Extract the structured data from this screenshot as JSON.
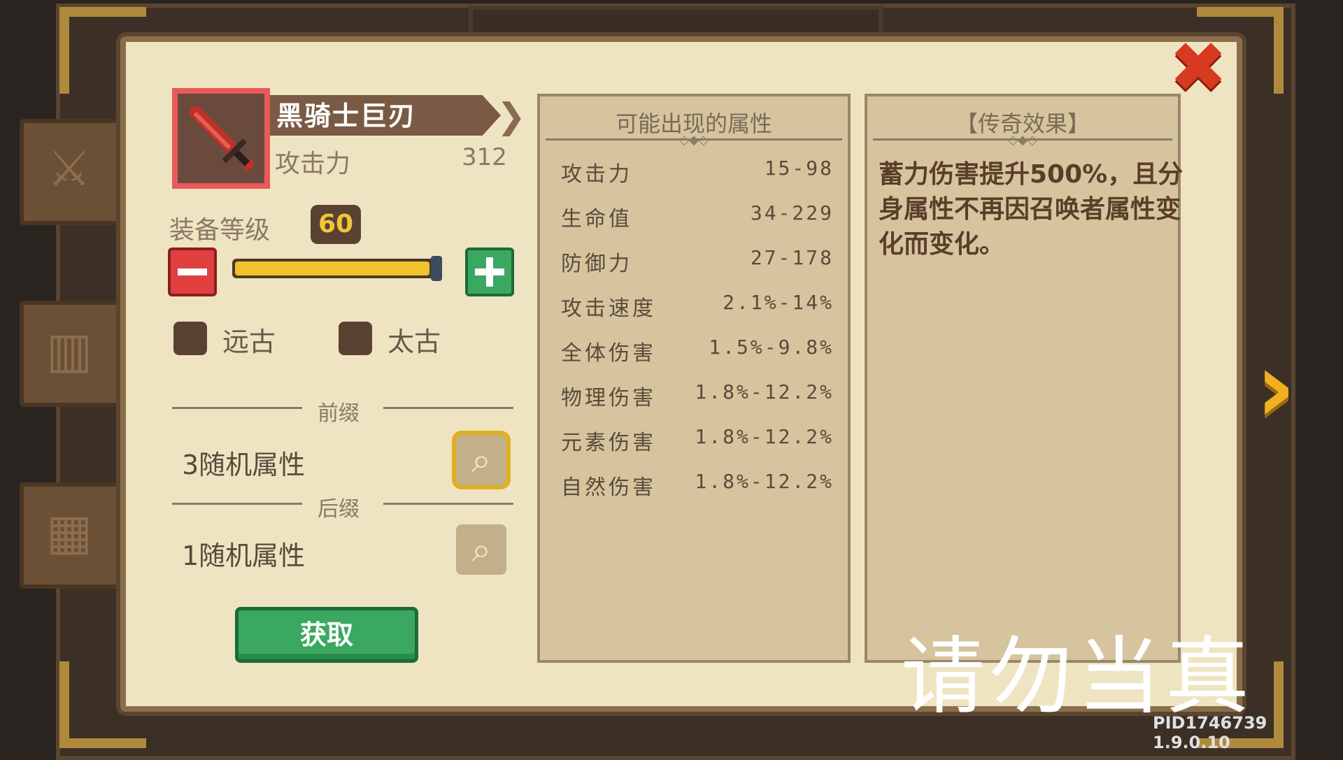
{
  "item": {
    "name": "黑骑士巨刃",
    "stat_label": "攻击力",
    "stat_value": "312"
  },
  "level": {
    "label": "装备等级",
    "value": "60",
    "slider_fraction": 1.0
  },
  "options": [
    {
      "label": "远古",
      "checked": false
    },
    {
      "label": "太古",
      "checked": false
    }
  ],
  "prefix": {
    "label": "前缀",
    "text": "3随机属性"
  },
  "suffix": {
    "label": "后缀",
    "text": "1随机属性"
  },
  "get_button": "获取",
  "possible_attrs": {
    "title": "可能出现的属性",
    "rows": [
      {
        "name": "攻击力",
        "range": "15-98"
      },
      {
        "name": "生命值",
        "range": "34-229"
      },
      {
        "name": "防御力",
        "range": "27-178"
      },
      {
        "name": "攻击速度",
        "range": "2.1%-14%"
      },
      {
        "name": "全体伤害",
        "range": "1.5%-9.8%"
      },
      {
        "name": "物理伤害",
        "range": "1.8%-12.2%"
      },
      {
        "name": "元素伤害",
        "range": "1.8%-12.2%"
      },
      {
        "name": "自然伤害",
        "range": "1.8%-12.2%"
      }
    ]
  },
  "legend": {
    "title": "【传奇效果】",
    "text": "蓄力伤害提升500%，且分身属性不再因召唤者属性变化而变化。"
  },
  "watermark": "请勿当真",
  "pid": "PID1746739 1.9.0.10",
  "icons": {
    "close": "close-icon",
    "next": "chevron-right-icon",
    "zoom": "magnifier-icon",
    "weapon": "sword-icon"
  },
  "colors": {
    "panel": "#efe4c2",
    "box": "#d6c49e",
    "accent_green": "#3aa860",
    "accent_red": "#e04040",
    "badge_text": "#f2c63a"
  }
}
